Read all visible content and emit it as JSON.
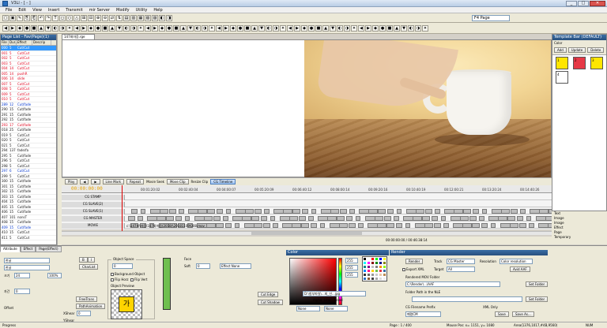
{
  "window": {
    "title": "V3Ll - [ - ]"
  },
  "menu": [
    "File",
    "Edit",
    "View",
    "Insert",
    "Transmit",
    "mir Server",
    "Modify",
    "Utility",
    "Help"
  ],
  "toolbar": {
    "page_combo": "F4 Page"
  },
  "page_list": {
    "header": "Page List - Fav(Page)(1)",
    "columns": [
      "File",
      "Dur...",
      "Effect",
      "Descrip"
    ],
    "rows": [
      {
        "file": "000 U",
        "dur": "5",
        "effect": "Cut/Cut",
        "color": "red"
      },
      {
        "file": "001 U",
        "dur": "5",
        "effect": "Cut/Cut",
        "color": "red"
      },
      {
        "file": "002 U",
        "dur": "5",
        "effect": "Cut/Cut",
        "color": "red"
      },
      {
        "file": "003 U",
        "dur": "5",
        "effect": "Cut/Cut",
        "color": "red"
      },
      {
        "file": "004 U",
        "dur": "14",
        "effect": "Cut/Cut",
        "color": "red"
      },
      {
        "file": "005 U",
        "dur": "14",
        "effect": "pushR",
        "color": "red"
      },
      {
        "file": "006 U",
        "dur": "14",
        "effect": "slide",
        "color": "red"
      },
      {
        "file": "007 U",
        "dur": "5",
        "effect": "Cut/Cut",
        "color": "red"
      },
      {
        "file": "008 U",
        "dur": "5",
        "effect": "Cut/Cut",
        "color": "red"
      },
      {
        "file": "009 U",
        "dur": "5",
        "effect": "Cut/Cut",
        "color": "red"
      },
      {
        "file": "010 U",
        "dur": "5",
        "effect": "Cut/Cut",
        "color": "red"
      },
      {
        "file": "289 S",
        "dur": "12",
        "effect": "Cut/fade",
        "color": "blue"
      },
      {
        "file": "290 M",
        "dur": "15",
        "effect": "Cut/fade",
        "color": "black"
      },
      {
        "file": "291 M",
        "dur": "15",
        "effect": "Cut/fade",
        "color": "black"
      },
      {
        "file": "292 M",
        "dur": "15",
        "effect": "Cut/fade",
        "color": "black"
      },
      {
        "file": "293 U",
        "dur": "17",
        "effect": "Cut/fade",
        "color": "red"
      },
      {
        "file": "018 M",
        "dur": "25",
        "effect": "Cut/fade",
        "color": "black"
      },
      {
        "file": "019 M",
        "dur": "5",
        "effect": "Cut/Cut",
        "color": "black"
      },
      {
        "file": "020 M",
        "dur": "5",
        "effect": "Cut/Cut",
        "color": "black"
      },
      {
        "file": "021 M",
        "dur": "5",
        "effect": "Cut/Cut",
        "color": "black"
      },
      {
        "file": "294 M",
        "dur": "137",
        "effect": "fade/fa",
        "color": "black"
      },
      {
        "file": "295 M",
        "dur": "5",
        "effect": "Cut/fade",
        "color": "black"
      },
      {
        "file": "296 M",
        "dur": "5",
        "effect": "Cut/Cut",
        "color": "black"
      },
      {
        "file": "298 M",
        "dur": "5",
        "effect": "Cut/Cut",
        "color": "black"
      },
      {
        "file": "297 S",
        "dur": "6",
        "effect": "Cut/Cut",
        "color": "blue"
      },
      {
        "file": "299 M",
        "dur": "5",
        "effect": "Cut/Cut",
        "color": "black"
      },
      {
        "file": "300 M",
        "dur": "15",
        "effect": "Cut/fade",
        "color": "black"
      },
      {
        "file": "301 M",
        "dur": "15",
        "effect": "Cut/fade",
        "color": "black"
      },
      {
        "file": "302 M",
        "dur": "15",
        "effect": "Cut/fade",
        "color": "black"
      },
      {
        "file": "303 M",
        "dur": "15",
        "effect": "Cut/fade",
        "color": "black"
      },
      {
        "file": "404 M",
        "dur": "15",
        "effect": "Cut/fade",
        "color": "black"
      },
      {
        "file": "405 M",
        "dur": "15",
        "effect": "Cut/fade",
        "color": "black"
      },
      {
        "file": "406 M",
        "dur": "15",
        "effect": "Cut/fade",
        "color": "black"
      },
      {
        "file": "407 M",
        "dur": "101",
        "effect": "nonsT",
        "color": "black"
      },
      {
        "file": "408 M",
        "dur": "15",
        "effect": "Cut/fade",
        "color": "black"
      },
      {
        "file": "409 U",
        "dur": "15",
        "effect": "Cut/fade",
        "color": "blue"
      },
      {
        "file": "410 U",
        "dur": "15",
        "effect": "Cut/Cut",
        "color": "black"
      },
      {
        "file": "411 M",
        "dur": "5",
        "effect": "Cut/Cut",
        "color": "black"
      }
    ]
  },
  "preview": {
    "tab_label": "147회마음.rge"
  },
  "transport": {
    "buttons": [
      "Play",
      "Line Mark",
      "Repeat",
      "Movie Seek",
      "Move Clip",
      "Resize Clip",
      "CG Timeline"
    ]
  },
  "timeline": {
    "timecode": "00:00:00:00",
    "ticks": [
      "00:01:20:02",
      "00:02:40:04",
      "00:04:00:07",
      "00:05:20:09",
      "00:06:40:12",
      "00:08:00:14",
      "00:09:20:16",
      "00:10:40:19",
      "00:12:00:21",
      "00:13:20:24",
      "00:14:40:26"
    ],
    "tracks": [
      "CG STAMP",
      "CG SLAVE(2)",
      "CG SLAVE(1)",
      "CG MASTER",
      "MOVIE"
    ],
    "movie_clip": "c:\\147회\\마음\\147회마음(2018)\\20181109\\008.mov",
    "range": "00:00:00:00 / 00:46:38:14"
  },
  "template_bar": {
    "header": "Template Bar (DEFAULT)",
    "sub": "Color",
    "buttons": [
      "Add",
      "Update",
      "Delete"
    ],
    "swatches": [
      {
        "label": "1",
        "color": "#ffe600"
      },
      {
        "label": "2",
        "color": "#e63946"
      },
      {
        "label": "3",
        "color": "#ffe600"
      },
      {
        "label": "4",
        "color": "#ffffff"
      }
    ]
  },
  "right_list": [
    "Text",
    "Image",
    "Image",
    "Effect",
    "Page",
    "Temporary"
  ],
  "attributes": {
    "tabs": [
      "Attribute",
      "Effect",
      "Page(Effect)"
    ],
    "font": "한글",
    "font2": "한글",
    "size_label": "크기",
    "size": "24",
    "size2": "100%",
    "space_label": "자간",
    "space": "0",
    "offset_label": "Offset",
    "charlist": "CharList",
    "freetrans": "FreeTrans",
    "pathanim": "PathAnimation",
    "object_space_label": "Object Space",
    "object_space": "0",
    "xshear_label": "XShear",
    "xshear": "0",
    "yshear_label": "YShear",
    "yshear": "0",
    "bg_object": "Background Object",
    "flip_horz": "Flip Horz",
    "flip_vert": "Flip Vert",
    "object_preview": "Object Preview",
    "preview_glyph": "가",
    "face_label": "Face",
    "soft_label": "Soft",
    "soft": "0",
    "effect": "Effect None",
    "cut_edge": "Cut Edge",
    "cut_shadow": "Cut Shadow"
  },
  "color_panel": {
    "header": "Color",
    "r": "255",
    "g": "255",
    "b": "255",
    "a": "255",
    "alpha_label": "Alpha",
    "line_label": "Line",
    "level_label": "Level",
    "combo1": "None",
    "combo2": "None",
    "file": "D:\\첨부파일\\...회_선...jpg"
  },
  "render": {
    "header": "Render",
    "render_btn": "Render",
    "track_label": "Track",
    "track": "CG Master",
    "resolution_label": "Resolution",
    "resolution": "Color resolution",
    "export_xml": "Export XML",
    "target_label": "Target",
    "target": "All",
    "avid_aaf": "Avid AAF",
    "rendered_mov_label": "Rendered MOV Folder",
    "rendered_mov": "C:\\Render\\...\\AAF",
    "set_folder": "Set Folder",
    "folder_nle_label": "Folder Path in the NLE",
    "folder_nle": "",
    "set_folder2": "Set Folder",
    "cg_prefix_label": "CG Filename Prefix",
    "cg_prefix": "폐렴CM",
    "xml_only": "XML Only",
    "save": "Save",
    "save_as": "Save As..."
  },
  "status": {
    "left": "Progress",
    "page": "Page : 1 / 400",
    "mouse": "Mouse Pos: x= 1151, y= 1080",
    "area": "Area(1376,1017,#4B,9560)",
    "num": "NUM"
  },
  "colors": {
    "accent": "#3a6ea5",
    "playhead": "#e00000",
    "timecode": "#e8a400"
  }
}
